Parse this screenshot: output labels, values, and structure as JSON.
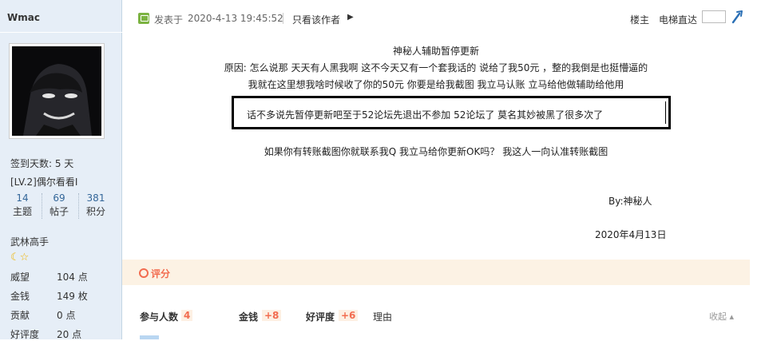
{
  "sidebar": {
    "username": "Wmac",
    "checkin": "签到天数: 5 天",
    "level": "[LV.2]偶尔看看I",
    "stats": [
      {
        "num": "14",
        "label": "主题"
      },
      {
        "num": "69",
        "label": "帖子"
      },
      {
        "num": "381",
        "label": "积分"
      }
    ],
    "rank": "武林高手",
    "attributes": [
      {
        "key": "威望",
        "value": "104 点"
      },
      {
        "key": "金钱",
        "value": "149 枚"
      },
      {
        "key": "贡献",
        "value": "0 点"
      },
      {
        "key": "好评度",
        "value": "20 点"
      }
    ]
  },
  "header": {
    "posted_label": "发表于",
    "posted_time": "2020-4-13 19:45:52",
    "only_author": "只看该作者",
    "floor": "楼主",
    "elevator": "电梯直达",
    "floor_input_value": ""
  },
  "post": {
    "title": "神秘人辅助暂停更新",
    "line1": "原因: 怎么说那 天天有人黑我啊 这不今天又有一个套我话的 说给了我50元 ，整的我倒是也挺懵逼的",
    "line2": "我就在这里想我啥时候收了你的50元 你要是给我截图 我立马认账 立马给他做辅助给他用",
    "boxed": "话不多说先暂停更新吧至于52论坛先退出不参加 52论坛了 莫名其妙被黑了很多次了",
    "line3": "如果你有转账截图你就联系我Q 我立马给你更新OK吗？  我这人一向认准转账截图",
    "signature": "By:神秘人",
    "date": "2020年4月13日"
  },
  "rating": {
    "label": "评分",
    "participants_label": "参与人数",
    "participants_value": "4",
    "money_label": "金钱",
    "money_value": "+8",
    "goodrate_label": "好评度",
    "goodrate_value": "+6",
    "reason_label": "理由",
    "collapse_label": "收起"
  },
  "colors": {
    "sidebar_bg": "#e6eef7",
    "accent": "#f26c4f",
    "link": "#336699",
    "rate_bar_bg": "#fcf2e4"
  }
}
